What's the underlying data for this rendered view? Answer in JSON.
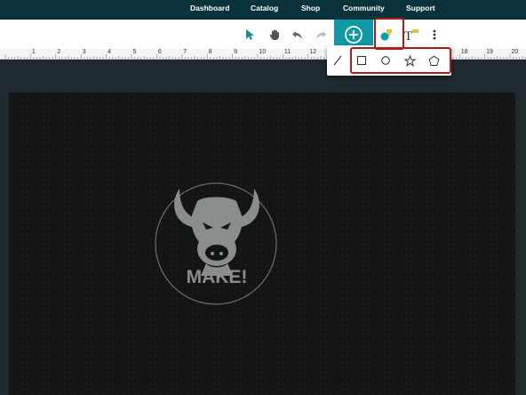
{
  "nav": {
    "dashboard": "Dashboard",
    "catalog": "Catalog",
    "shop": "Shop",
    "community": "Community",
    "support": "Support"
  },
  "toolbar": {
    "icons": [
      "select-arrow-icon",
      "hand-pan-icon",
      "undo-icon",
      "redo-icon",
      "add-plus-icon",
      "shapes-icon",
      "text-icon",
      "more-vertical-icon"
    ]
  },
  "ruler": {
    "labels": [
      "1",
      "2",
      "3",
      "4",
      "5",
      "6",
      "7",
      "8",
      "9",
      "10",
      "11",
      "12",
      "13",
      "14",
      "15",
      "16",
      "17",
      "18",
      "19",
      "20"
    ]
  },
  "shapes_menu": {
    "items": [
      "line-icon",
      "square-icon",
      "circle-icon",
      "star-icon",
      "pentagon-icon"
    ]
  },
  "canvas": {
    "logo_text": "MAKE!"
  },
  "colors": {
    "nav_bg": "#09323a",
    "accent": "#0f9aa6",
    "highlight": "#b01b1b",
    "canvas_bg": "#121415",
    "logo": "#8a8d8e"
  }
}
